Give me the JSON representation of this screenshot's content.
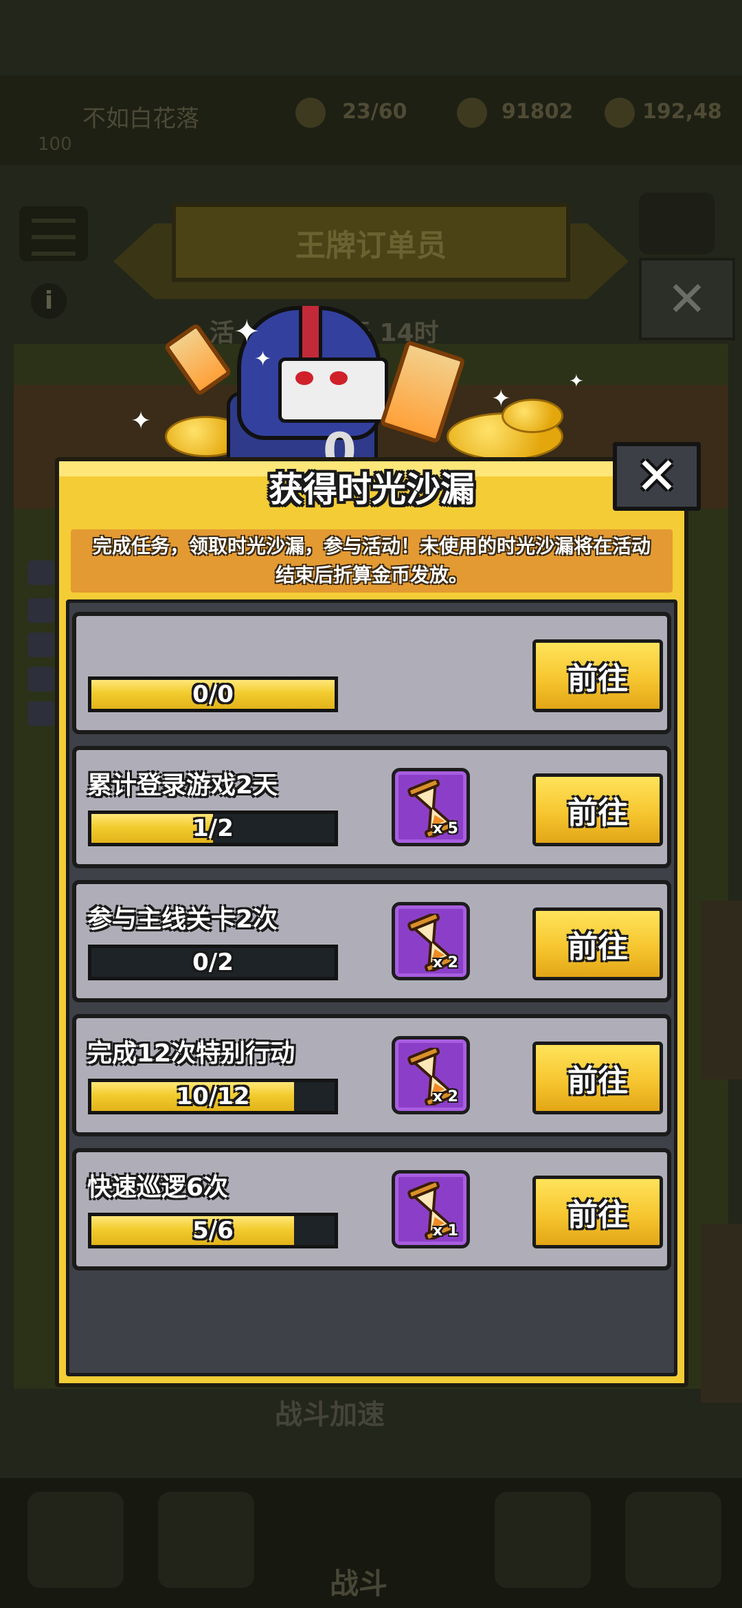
{
  "background": {
    "player_name": "不如白花落",
    "player_level": "100",
    "resources": [
      "23/60",
      "91802",
      "192,48"
    ],
    "banner_title": "王牌订单员",
    "event_timer": "活",
    "event_timer_suffix": "04天 14时",
    "bottom_label": "战斗加速",
    "tab_label": "战斗"
  },
  "modal": {
    "title": "获得时光沙漏",
    "close_glyph": "✕",
    "notice": "完成任务，领取时光沙漏，参与活动！未使用的时光沙漏将在活动结束后折算金币发放。",
    "tasks": [
      {
        "label": "",
        "progress_text": "0/0",
        "current": 0,
        "target": 0,
        "fill": 1.0,
        "reward_qty": "",
        "button": "前往"
      },
      {
        "label": "累计登录游戏2天",
        "progress_text": "1/2",
        "current": 1,
        "target": 2,
        "fill": 0.5,
        "reward_qty": "x 5",
        "button": "前往"
      },
      {
        "label": "参与主线关卡2次",
        "progress_text": "0/2",
        "current": 0,
        "target": 2,
        "fill": 0.0,
        "reward_qty": "x 2",
        "button": "前往"
      },
      {
        "label": "完成12次特别行动",
        "progress_text": "10/12",
        "current": 10,
        "target": 12,
        "fill": 0.8333,
        "reward_qty": "x 2",
        "button": "前往"
      },
      {
        "label": "快速巡逻6次",
        "progress_text": "5/6",
        "current": 5,
        "target": 6,
        "fill": 0.8333,
        "reward_qty": "x 1",
        "button": "前往"
      }
    ]
  },
  "colors": {
    "panel": "#f4cc35",
    "task_bg": "#afaeb8",
    "reward_bg": "#8b3fc8",
    "bar_fill": "#f2cc2e"
  },
  "icons": {
    "reward": "hourglass-icon",
    "close": "close-icon"
  }
}
